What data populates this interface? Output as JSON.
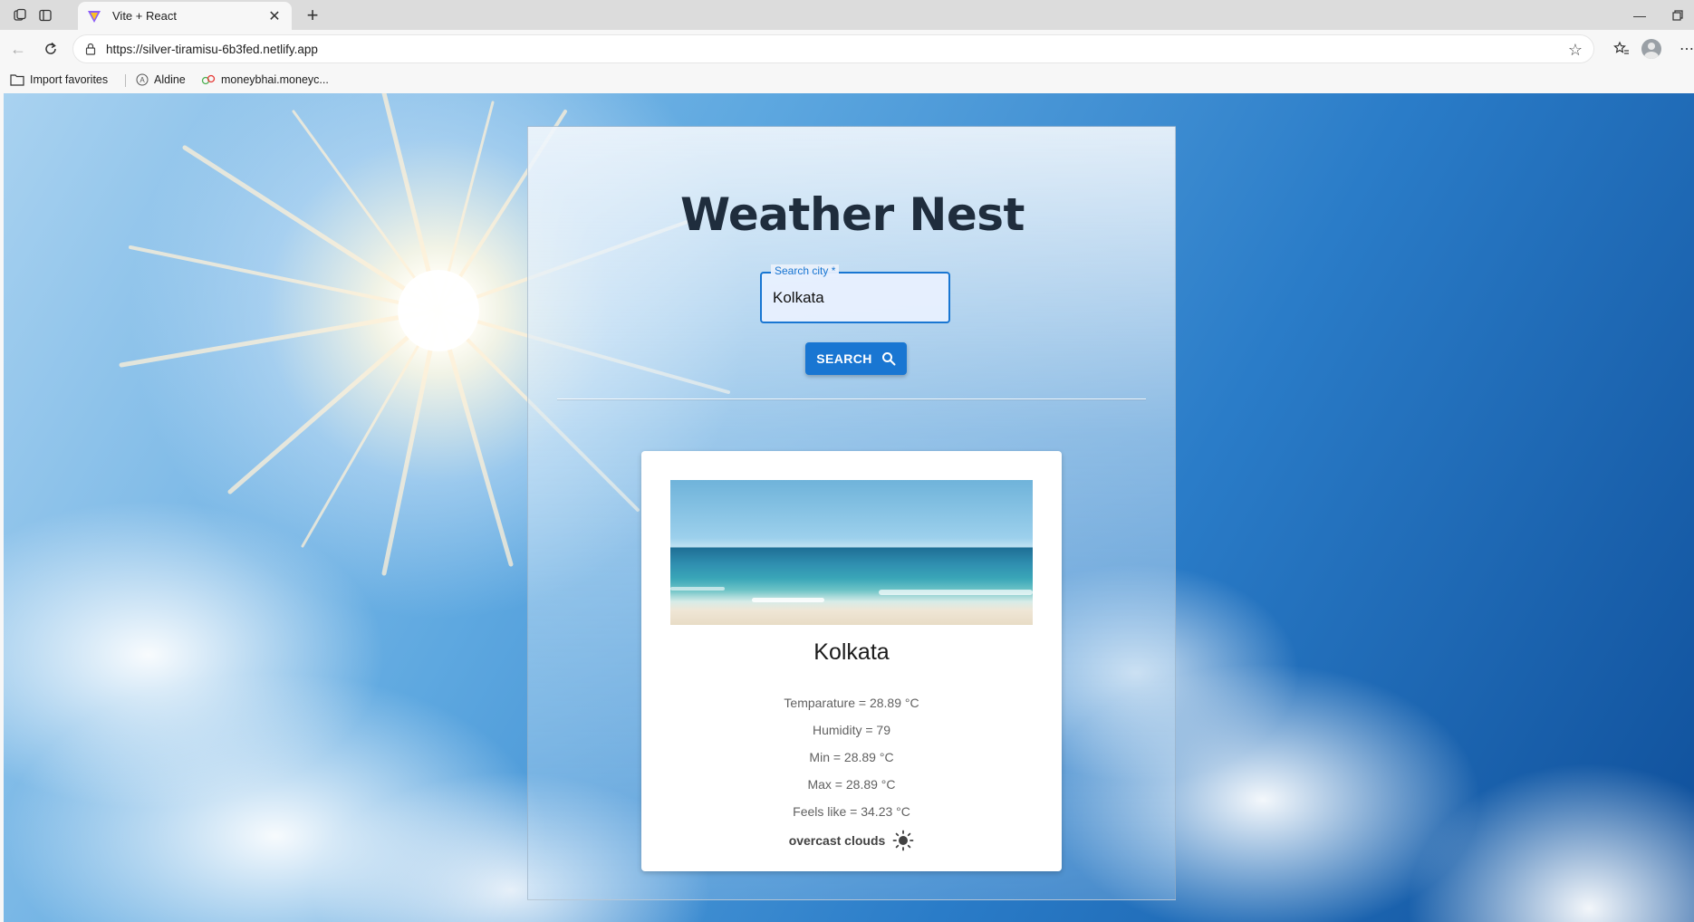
{
  "browser": {
    "tab_title": "Vite + React",
    "url": "https://silver-tiramisu-6b3fed.netlify.app",
    "bookmarks": [
      "Import favorites",
      "Aldine",
      "moneybhai.moneyc..."
    ]
  },
  "app": {
    "title": "Weather Nest",
    "search": {
      "label": "Search city *",
      "value": "Kolkata"
    },
    "search_button_label": "SEARCH"
  },
  "weather": {
    "city": "Kolkata",
    "temperature": "Temparature = 28.89 °C",
    "humidity": "Humidity = 79",
    "min": "Min = 28.89 °C",
    "max": "Max = 28.89 °C",
    "feels_like": "Feels like = 34.23 °C",
    "description": "overcast clouds",
    "condition_icon": "sun-icon"
  },
  "colors": {
    "primary": "#1976d2",
    "title": "#1f2d3d"
  }
}
